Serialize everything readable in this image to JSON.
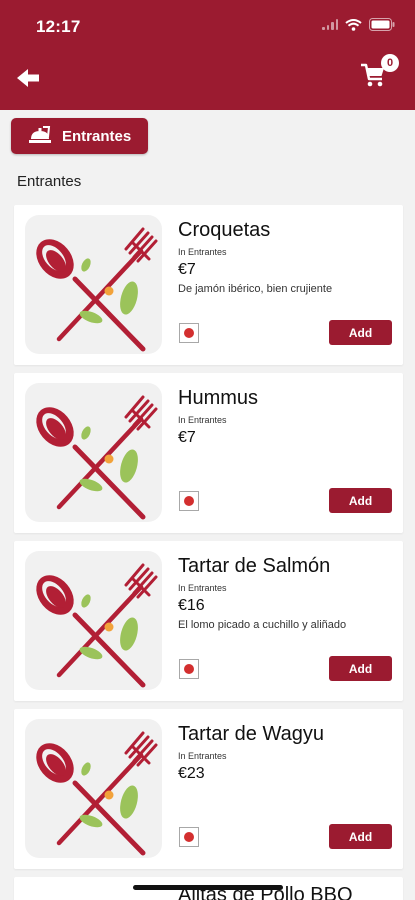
{
  "status_bar": {
    "time": "12:17"
  },
  "header": {
    "back_icon": "arrow-left-icon",
    "cart_icon": "shopping-cart-icon",
    "cart_count": "0"
  },
  "category": {
    "label": "Entrantes",
    "icon": "food-tray-icon"
  },
  "section": {
    "title": "Entrantes"
  },
  "items": [
    {
      "name": "Croquetas",
      "category": "In Entrantes",
      "price": "€7",
      "description": "De jamón ibérico, bien crujiente",
      "add_label": "Add"
    },
    {
      "name": "Hummus",
      "category": "In Entrantes",
      "price": "€7",
      "description": "",
      "add_label": "Add"
    },
    {
      "name": "Tartar de Salmón",
      "category": "In Entrantes",
      "price": "€16",
      "description": "El lomo picado a cuchillo y aliñado",
      "add_label": "Add"
    },
    {
      "name": "Tartar de Wagyu",
      "category": "In Entrantes",
      "price": "€23",
      "description": "",
      "add_label": "Add"
    },
    {
      "name": "Alitas de Pollo BBQ"
    }
  ],
  "colors": {
    "primary": "#9b1b30",
    "dot": "#d32f2f"
  }
}
